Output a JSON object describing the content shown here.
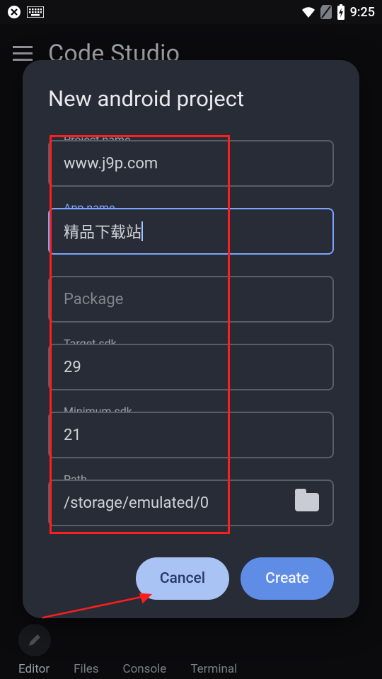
{
  "statusbar": {
    "time": "9:25"
  },
  "toolbar": {
    "title": "Code Studio"
  },
  "dialog": {
    "title": "New android project",
    "fields": {
      "project_name": {
        "label": "Project name",
        "value": "www.j9p.com"
      },
      "app_name": {
        "label": "App name",
        "value": "精品下载站"
      },
      "package": {
        "label": "",
        "placeholder": "Package"
      },
      "target_sdk": {
        "label": "Target sdk",
        "value": "29"
      },
      "minimum_sdk": {
        "label": "Minimum sdk",
        "value": "21"
      },
      "path": {
        "label": "Path",
        "value": "/storage/emulated/0"
      }
    },
    "actions": {
      "cancel": "Cancel",
      "create": "Create"
    }
  },
  "tabs": {
    "editor": "Editor",
    "files": "Files",
    "console": "Console",
    "terminal": "Terminal"
  }
}
